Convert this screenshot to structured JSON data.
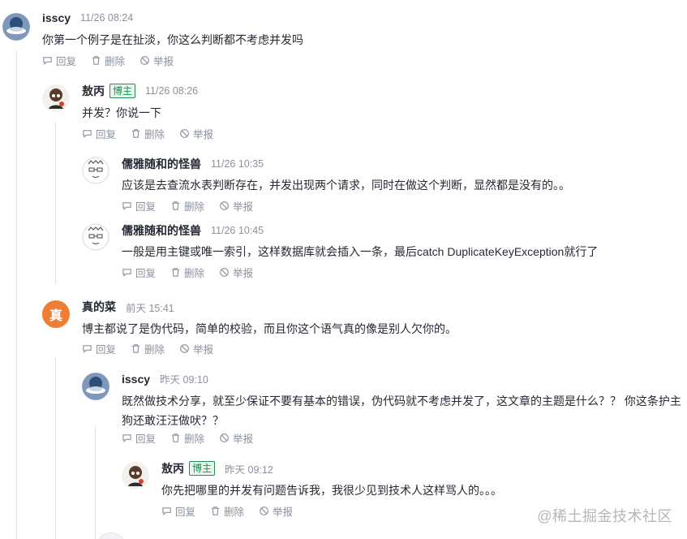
{
  "actions": {
    "reply": "回复",
    "delete": "删除",
    "report": "举报"
  },
  "icons": [
    "comment-icon",
    "trash-icon",
    "ban-icon"
  ],
  "colors": {
    "accent_avatar": "#ee7d35",
    "badge_green": "#1e8f4e",
    "meta_gray": "#8a919f"
  },
  "comments": [
    {
      "author": "isscy",
      "time": "11/26 08:24",
      "text": "你第一个例子是在扯淡，你这么判断都不考虑并发吗"
    },
    {
      "author": "敖丙",
      "badge": "博主",
      "time": "11/26 08:26",
      "text": "并发？你说一下"
    },
    {
      "author": "儒雅随和的怪兽",
      "time": "11/26 10:35",
      "text": "应该是去查流水表判断存在，并发出现两个请求，同时在做这个判断，显然都是没有的。。"
    },
    {
      "author": "儒雅随和的怪兽",
      "time": "11/26 10:45",
      "text": "一般是用主键或唯一索引，这样数据库就会插入一条，最后catch DuplicateKeyException就行了"
    },
    {
      "author": "真的菜",
      "avatar_letter": "真",
      "time": "前天 15:41",
      "text": "博主都说了是伪代码，简单的校验，而且你这个语气真的像是别人欠你的。"
    },
    {
      "author": "isscy",
      "time": "昨天 09:10",
      "text": "既然做技术分享，就至少保证不要有基本的错误，伪代码就不考虑并发了，这文章的主题是什么？？ 你这条护主狗还敢汪汪做吠？？"
    },
    {
      "author": "敖丙",
      "badge": "博主",
      "time": "昨天 09:12",
      "text": "你先把哪里的并发有问题告诉我，我很少见到技术人这样骂人的。。。"
    }
  ],
  "watermark": "@稀土掘金技术社区"
}
